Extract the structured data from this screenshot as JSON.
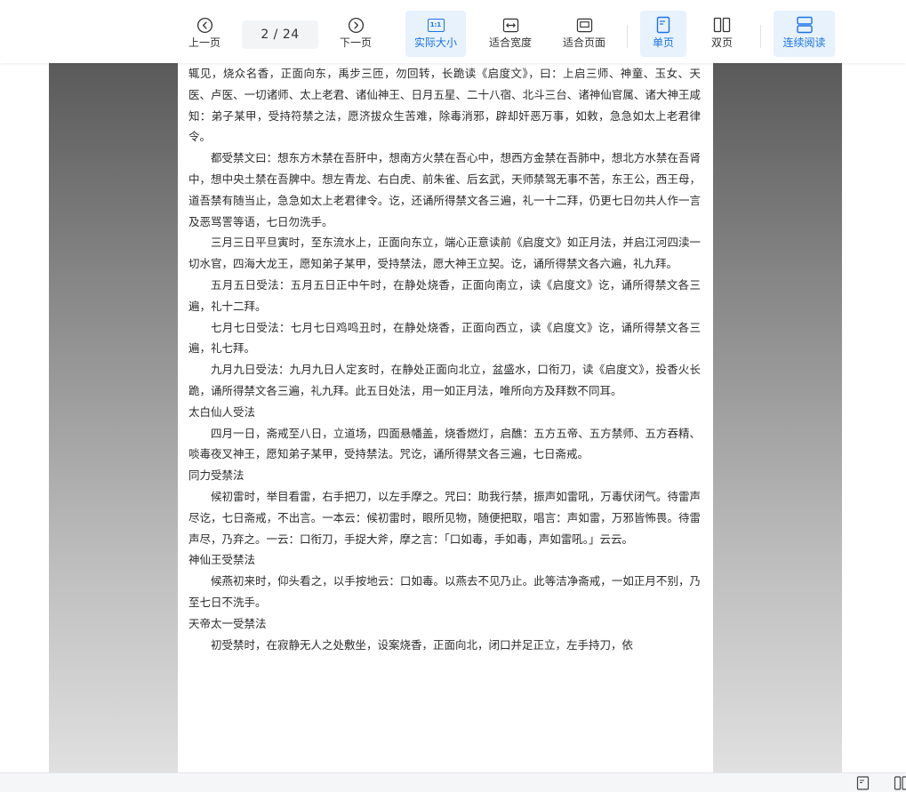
{
  "toolbar": {
    "prev_label": "上一页",
    "next_label": "下一页",
    "current_page": "2",
    "total_pages": "24",
    "page_separator": " / ",
    "actual_size_label": "实际大小",
    "actual_size_icon_text": "1:1",
    "fit_width_label": "适合宽度",
    "fit_page_label": "适合页面",
    "single_page_label": "单页",
    "double_page_label": "双页",
    "continuous_label": "连续阅读",
    "accent_color": "#1a73e8",
    "active_bg": "#e7f2fd"
  },
  "document": {
    "paragraphs": [
      {
        "type": "first",
        "text": "辄见，烧众名香，正面向东，禹步三匝，勿回转，长跪读《启度文》，曰：上启三师、神童、玉女、天医、卢医、一切诸师、太上老君、诸仙神王、日月五星、二十八宿、北斗三台、诸神仙官属、诸大神王咸知：弟子某甲，受持符禁之法，愿济拔众生苦难，除毒消邪，辟却奸恶万事，如敕，急急如太上老君律令。"
      },
      {
        "type": "para",
        "text": "都受禁文曰：想东方木禁在吾肝中，想南方火禁在吾心中，想西方金禁在吾肺中，想北方水禁在吾肾中，想中央土禁在吾脾中。想左青龙、右白虎、前朱雀、后玄武，天师禁驾无事不苦，东王公，西王母，道吾禁有随当止，急急如太上老君律令。讫，还诵所得禁文各三遍，礼一十二拜，仍更七日勿共人作一言及恶骂詈等语，七日勿洗手。"
      },
      {
        "type": "para",
        "text": "三月三日平旦寅时，至东流水上，正面向东立，端心正意读前《启度文》如正月法，并启江河四渎一切水官，四海大龙王，愿知弟子某甲，受持禁法，愿大神王立契。讫，诵所得禁文各六遍，礼九拜。"
      },
      {
        "type": "para",
        "text": "五月五日受法：五月五日正中午时，在静处烧香，正面向南立，读《启度文》讫，诵所得禁文各三遍，礼十二拜。"
      },
      {
        "type": "para",
        "text": "七月七日受法：七月七日鸡鸣丑时，在静处烧香，正面向西立，读《启度文》讫，诵所得禁文各三遍，礼七拜。"
      },
      {
        "type": "para",
        "text": "九月九日受法：九月九日人定亥时，在静处正面向北立，盆盛水，口衔刀，读《启度文》，投香火长跪，诵所得禁文各三遍，礼九拜。此五日处法，用一如正月法，唯所向方及拜数不同耳。"
      },
      {
        "type": "heading",
        "text": "太白仙人受法"
      },
      {
        "type": "para",
        "text": "四月一日，斋戒至八日，立道场，四面悬幡盖，烧香燃灯，启醮：五方五帝、五方禁师、五方吞精、啖毒夜叉神王，愿知弟子某甲，受持禁法。咒讫，诵所得禁文各三遍，七日斋戒。"
      },
      {
        "type": "heading",
        "text": "同力受禁法"
      },
      {
        "type": "para",
        "text": "候初雷时，举目看雷，右手把刀，以左手摩之。咒曰：助我行禁，振声如雷吼，万毒伏闭气。待雷声尽讫，七日斋戒，不出言。一本云：候初雷时，眼所见物，随便把取，唱言：声如雷，万邪皆怖畏。待雷声尽，乃弃之。一云：口衔刀，手捉大斧，摩之言：「口如毒，手如毒，声如雷吼。」云云。"
      },
      {
        "type": "heading",
        "text": "神仙王受禁法"
      },
      {
        "type": "para",
        "text": "候燕初来时，仰头看之，以手按地云：口如毒。以燕去不见乃止。此等洁净斋戒，一如正月不别，乃至七日不洗手。"
      },
      {
        "type": "heading",
        "text": "天帝太一受禁法"
      },
      {
        "type": "para",
        "text": "初受禁时，在寂静无人之处敷坐，设案烧香，正面向北，闭口并足正立，左手持刀，依"
      }
    ]
  }
}
